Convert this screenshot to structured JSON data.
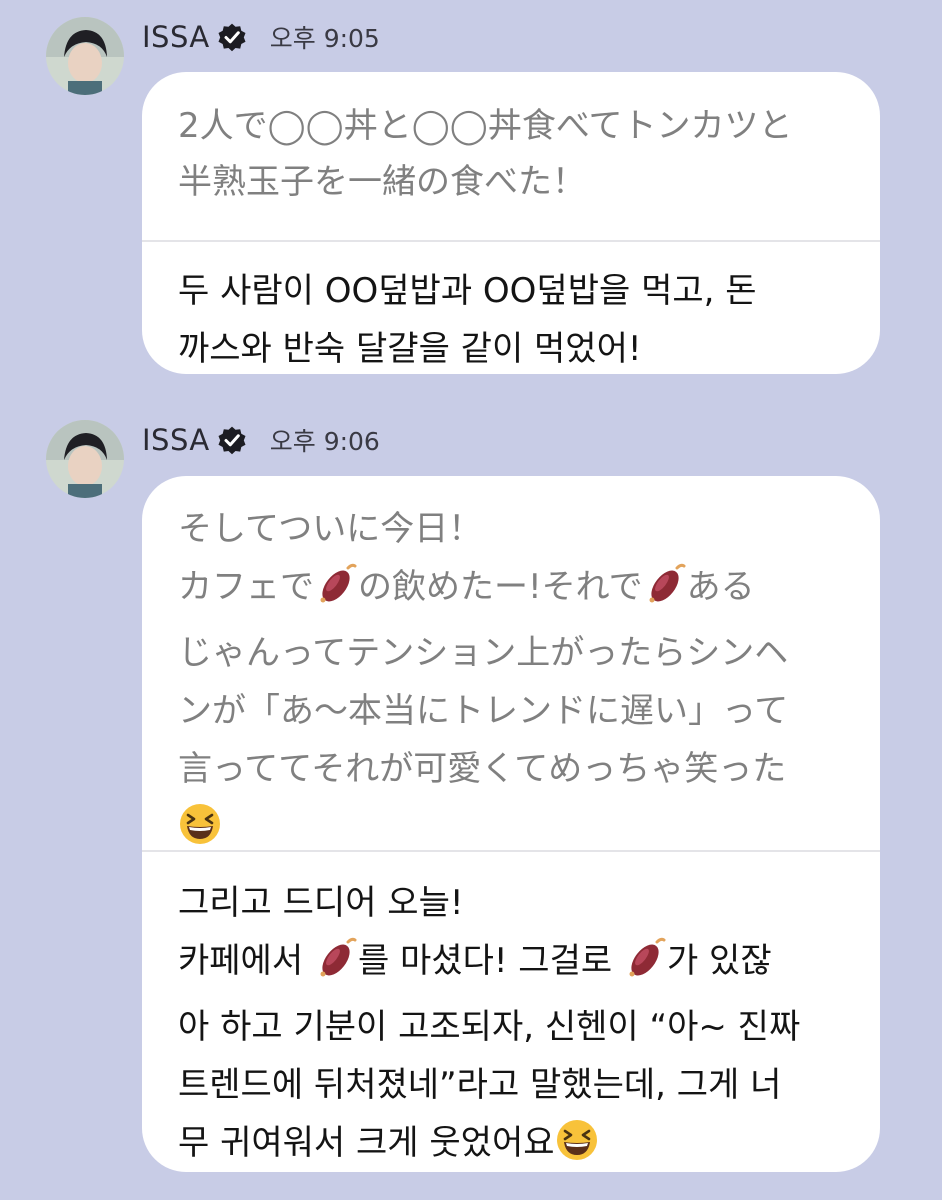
{
  "messages": [
    {
      "sender": "ISSA",
      "time": "오후 9:05",
      "original_text": "2人で◯◯丼と◯◯丼食べてトンカツと\n半熟玉子を一緒の食べた！",
      "translated_text": "두 사람이 OO덮밥과 OO덮밥을 먹고, 돈\n까스와 반숙 달걀을 같이 먹었어!"
    },
    {
      "sender": "ISSA",
      "time": "오후 9:06",
      "original_parts": [
        "そしてついに今日！\nカフェで",
        "の飲めたー!それで",
        "ある\nじゃんってテンション上がったらシンヘ\nンが「あ～本当にトレンドに遅い」って\n言っててそれが可愛くてめっちゃ笑った\n"
      ],
      "translated_parts": [
        "그리고 드디어 오늘!\n카페에서 ",
        "를 마셨다! 그걸로 ",
        "가 있잖\n아 하고 기분이 고조되자, 신헨이 “아~ 진짜\n 트렌드에 뒤처졌네”라고 말했는데, 그게 너\n무 귀여워서 크게 웃었어요"
      ],
      "emoji_names": [
        "sweet-potato-emoji",
        "laughing-emoji"
      ]
    }
  ]
}
